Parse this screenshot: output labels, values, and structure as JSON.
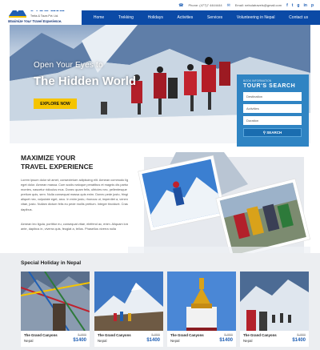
{
  "brand": {
    "name": "Nebula",
    "sub": "Treks & Tours Pvt. Ltd.",
    "tagline": "Maximize Your Travel Experience."
  },
  "topbar": {
    "phone": "Phone: (477)7 4444444",
    "email": "Email: nebulatravels@gmail.com"
  },
  "social": [
    "f",
    "t",
    "g",
    "in",
    "p"
  ],
  "nav": [
    "Home",
    "Trekking",
    "Holidays",
    "Activities",
    "Services",
    "Volunteering in Nepal",
    "Contact us"
  ],
  "hero": {
    "line1": "Open Your Eyes to",
    "line2": "The Hidden World",
    "button": "EXPLORE NOW"
  },
  "search": {
    "small": "BOOK INFORMATION",
    "title": "TOUR'S SEARCH",
    "fields": [
      "Destination",
      "Activities",
      "Duration"
    ],
    "button": "SEARCH"
  },
  "maximize": {
    "title1": "MAXIMIZE YOUR",
    "title2": "TRAVEL EXPERIENCE",
    "para1": "Lorem ipsum dolor sit amet, consectetuer adipiscing elit. Aenean commodo ligula eget dolor. Aenean massa. Cum sociis natoque penatibus et magnis dis parturient montes, nascetur ridiculus mus. Donec quam felis, ultricies nec, pellentesque eu, pretium quis, sem. Nulla consequat massa quis enim. Donec pede justo, fringilla vel, aliquet nec, vulputate eget, arcu. In enim justo, rhoncus ut, imperdiet a, venenatis vitae, justo. Nullam dictum felis eu pede mollis pretium. Integer tincidunt. Cras dapibus.",
    "para2": "Aenean leo ligula, porttitor eu, consequat vitae, eleifend ac, enim. Aliquam lorem ante, dapibus in, viverra quis, feugiat a, tellus. Phasellus viverra nulla"
  },
  "special": {
    "title": "Special Holiday in Nepal",
    "cards": [
      {
        "title": "The Grand Canyons",
        "location": "Nepal",
        "old": "$ 1800",
        "price": "$1400"
      },
      {
        "title": "The Grand Canyons",
        "location": "Nepal",
        "old": "$ 1800",
        "price": "$1400"
      },
      {
        "title": "The Grand Canyons",
        "location": "Nepal",
        "old": "$ 1800",
        "price": "$1400"
      },
      {
        "title": "The Grand Canyons",
        "location": "Nepal",
        "old": "$ 1800",
        "price": "$1400"
      }
    ]
  },
  "colors": {
    "nav": "#0b4aa6",
    "accent_yellow": "#f5c400",
    "search_panel": "#2f84c3",
    "price_blue": "#1f5fb4"
  }
}
